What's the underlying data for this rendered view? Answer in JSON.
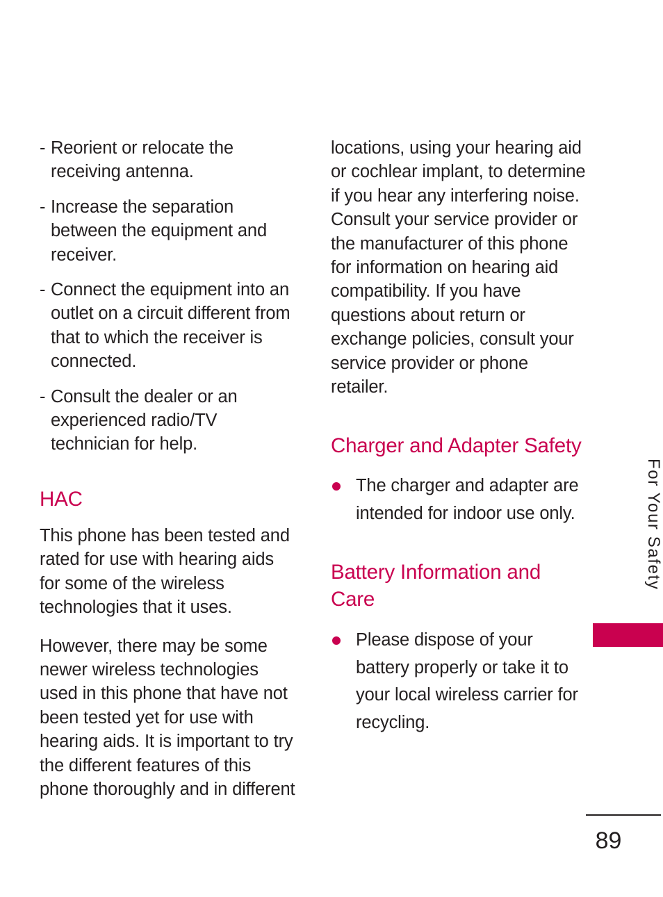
{
  "document": {
    "page_number": "89",
    "running_head": "For Your Safety",
    "accent_color": "#c9014f",
    "text_color": "#231f20"
  },
  "left_column": {
    "dash_bullets": [
      {
        "marker": "-",
        "text": "Reorient or relocate the receiving antenna."
      },
      {
        "marker": "-",
        "text": "Increase the separation between the equipment and receiver."
      },
      {
        "marker": "-",
        "text": "Connect the equipment into an outlet on a circuit different from that to which the receiver is connected."
      },
      {
        "marker": "-",
        "text": "Consult the dealer or an experienced radio/TV technician for help."
      }
    ],
    "hac": {
      "heading": "HAC",
      "paragraphs": [
        "This phone has been tested and rated for use with hearing aids for some of the wireless technologies that it uses.",
        "However, there may be some newer wireless technologies used in this phone that have not been tested yet for use with hearing aids. It is important to try the different features of this phone thoroughly and in different"
      ]
    }
  },
  "right_column": {
    "continued_paragraph": "locations, using your hearing aid or cochlear implant, to determine if you hear any interfering noise. Consult your service provider or the manufacturer of this phone for information on hearing aid compatibility. If you have questions about return or exchange policies, consult your service provider or phone retailer.",
    "charger_section": {
      "heading": "Charger and Adapter Safety",
      "bullets": [
        "The charger and adapter are intended for indoor use only."
      ]
    },
    "battery_section": {
      "heading": "Battery Information and Care",
      "bullets": [
        "Please dispose of your battery properly or take it to your local wireless carrier for recycling."
      ]
    }
  }
}
